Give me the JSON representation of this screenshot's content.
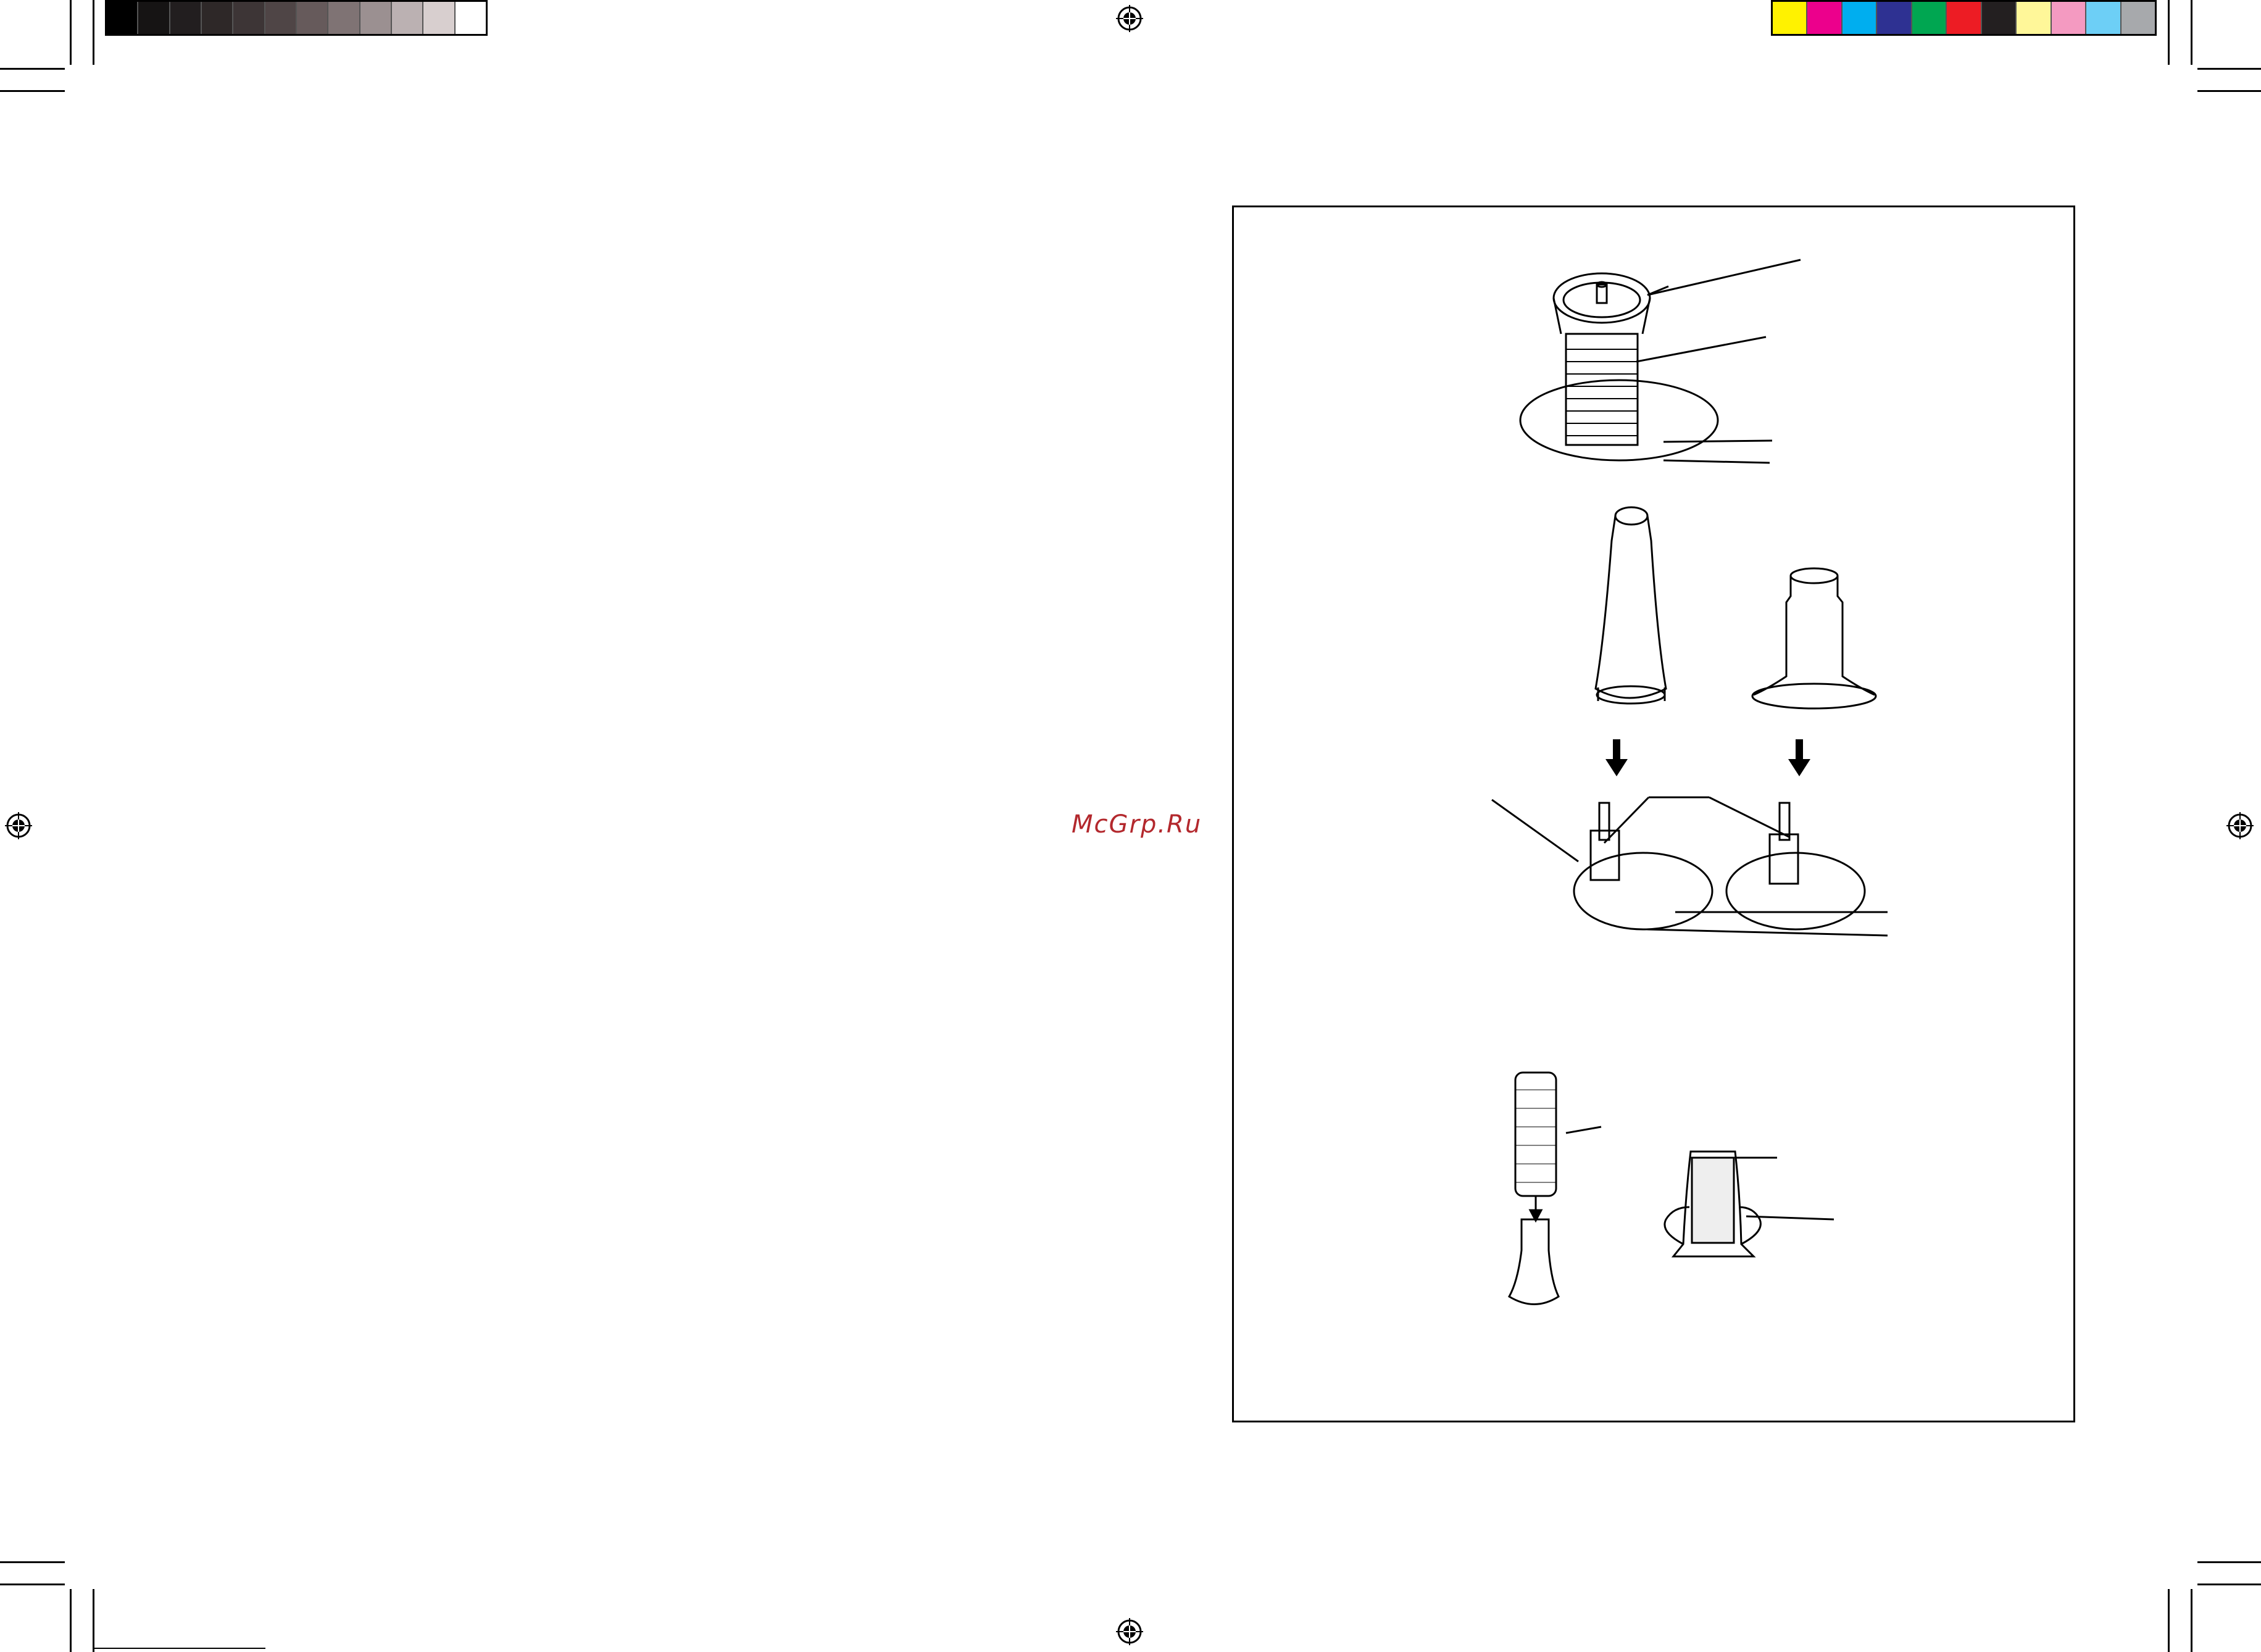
{
  "watermark": {
    "text": "McGrp.Ru",
    "color": "#b3282d"
  },
  "color_bars": {
    "grayscale": [
      "#000000",
      "#161414",
      "#221e1f",
      "#2e2828",
      "#3d3536",
      "#4f4546",
      "#665a5b",
      "#7f7374",
      "#9b9091",
      "#bbb1b2",
      "#d8cfcf",
      "#ffffff"
    ],
    "process": [
      "#fff200",
      "#ec008c",
      "#00aeef",
      "#2e3192",
      "#00a651",
      "#ed1c24",
      "#231f20",
      "#fff799",
      "#f49ac1",
      "#6dcff6",
      "#a7a9ac"
    ]
  },
  "figure": {
    "description_icons": [
      "thread-spool-with-cap",
      "cone-thread-spool",
      "small-thread-spool",
      "spool-pin-stand",
      "thread-net",
      "cone-holder"
    ]
  }
}
